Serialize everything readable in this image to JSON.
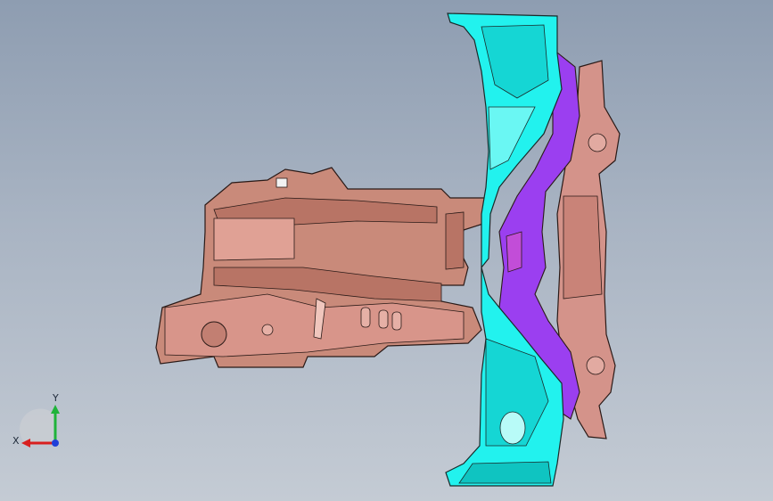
{
  "viewport": {
    "background_top": "#8e9db1",
    "background_bottom": "#c4cbd4"
  },
  "parts": {
    "left_panel_color": "#c98a7a",
    "cyan_panel_color": "#22f2ee",
    "purple_panel_color": "#9b3ff0",
    "pink_panel_color": "#d4938a"
  },
  "triad": {
    "x_label": "X",
    "y_label": "Y",
    "x_color": "#d81f1f",
    "y_color": "#1fb33a",
    "z_color": "#1f3fd8"
  }
}
